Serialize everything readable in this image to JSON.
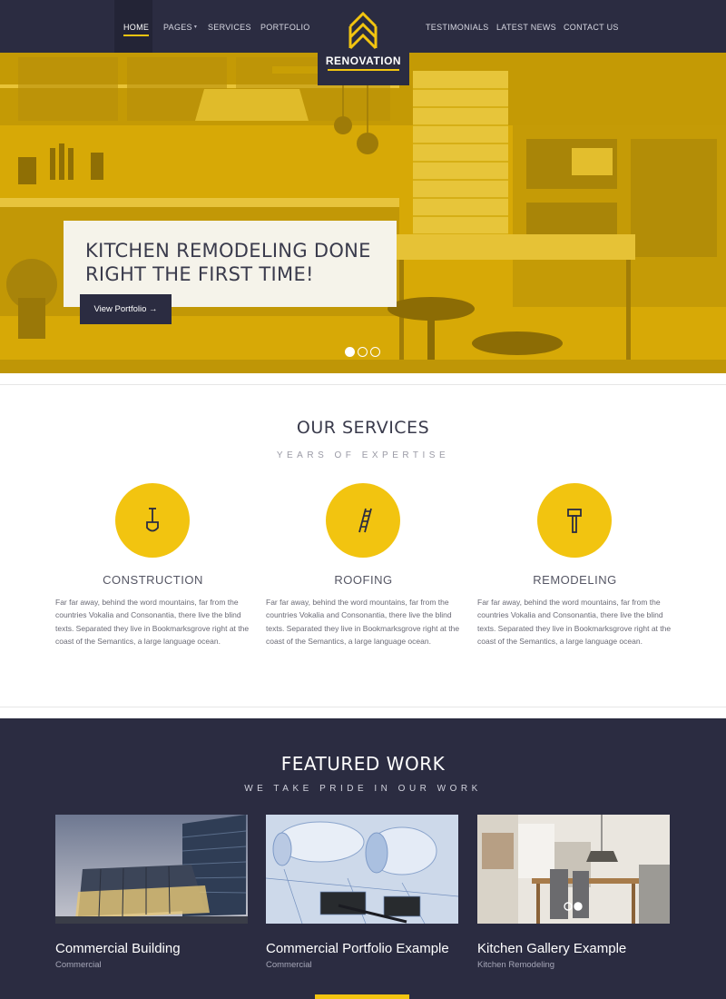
{
  "nav": {
    "items_left": [
      "HOME",
      "PAGES",
      "SERVICES",
      "PORTFOLIO"
    ],
    "items_right": [
      "TESTIMONIALS",
      "LATEST NEWS",
      "CONTACT US"
    ],
    "logo_text": "RENOVATION",
    "active": "HOME"
  },
  "hero": {
    "title": "KITCHEN REMODELING DONE RIGHT THE FIRST TIME!",
    "button_label": "View Portfolio →",
    "slides": 3,
    "active_slide": 1
  },
  "services": {
    "title": "OUR SERVICES",
    "subtitle": "YEARS OF EXPERTISE",
    "items": [
      {
        "name": "CONSTRUCTION",
        "icon": "shovel-icon",
        "text": "Far far away, behind the word mountains, far from the countries Vokalia and Consonantia, there live the blind texts. Separated they live in Bookmarksgrove right at the coast of the Semantics, a large language ocean."
      },
      {
        "name": "ROOFING",
        "icon": "ladder-icon",
        "text": "Far far away, behind the word mountains, far from the countries Vokalia and Consonantia, there live the blind texts. Separated they live in Bookmarksgrove right at the coast of the Semantics, a large language ocean."
      },
      {
        "name": "REMODELING",
        "icon": "hammer-icon",
        "text": "Far far away, behind the word mountains, far from the countries Vokalia and Consonantia, there live the blind texts. Separated they live in Bookmarksgrove right at the coast of the Semantics, a large language ocean."
      }
    ]
  },
  "featured": {
    "title": "FEATURED WORK",
    "subtitle": "WE TAKE PRIDE IN OUR WORK",
    "items": [
      {
        "title": "Commercial Building",
        "category": "Commercial"
      },
      {
        "title": "Commercial Portfolio Example",
        "category": "Commercial"
      },
      {
        "title": "Kitchen Gallery Example",
        "category": "Kitchen Remodeling"
      }
    ]
  },
  "colors": {
    "accent": "#f2c410",
    "navy": "#2b2c41",
    "hero_overlay": "#d8ab06"
  }
}
